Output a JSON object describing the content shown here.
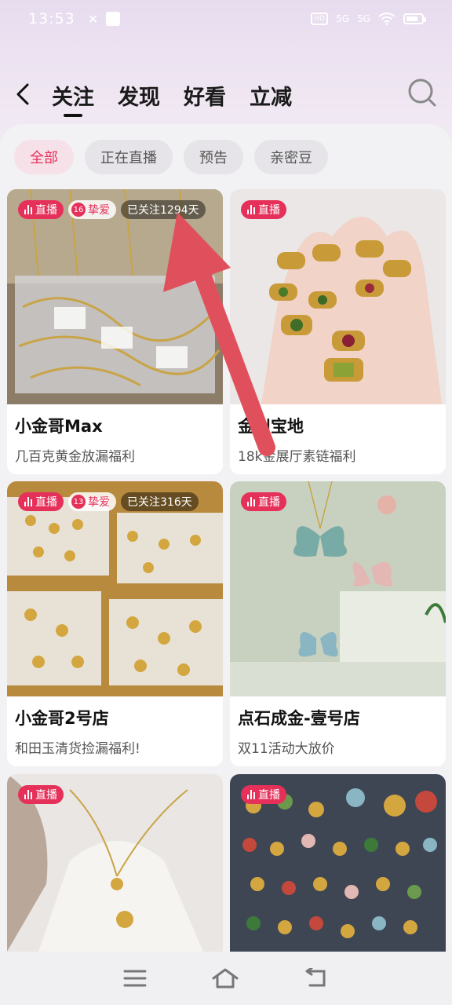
{
  "status_bar": {
    "time": "13:53",
    "icons": [
      "notification-app-icon",
      "app-icon"
    ],
    "right_icons": [
      "hd-icon",
      "5g-signal-icon",
      "5g-signal-icon",
      "wifi-icon",
      "battery-icon"
    ],
    "hd_label": "HD",
    "sig1": "5G",
    "sig2": "5G"
  },
  "nav": {
    "back": "<",
    "tabs": [
      {
        "label": "关注",
        "active": true
      },
      {
        "label": "发现",
        "active": false
      },
      {
        "label": "好看",
        "active": false
      },
      {
        "label": "立减",
        "active": false
      }
    ]
  },
  "filters": [
    {
      "label": "全部",
      "active": true
    },
    {
      "label": "正在直播",
      "active": false
    },
    {
      "label": "预告",
      "active": false
    },
    {
      "label": "亲密豆",
      "active": false
    }
  ],
  "cards": [
    {
      "live": "直播",
      "fan_level": "16",
      "fan_label": "挚爱",
      "follow": "已关注1294天",
      "title": "小金哥Max",
      "subtitle": "几百克黄金放漏福利"
    },
    {
      "live": "直播",
      "title": "金川宝地",
      "subtitle": "18k金展厅素链福利"
    },
    {
      "live": "直播",
      "fan_level": "13",
      "fan_label": "挚爱",
      "follow": "已关注316天",
      "title": "小金哥2号店",
      "subtitle": "和田玉清货捡漏福利!"
    },
    {
      "live": "直播",
      "title": "点石成金-壹号店",
      "subtitle": "双11活动大放价"
    },
    {
      "live": "直播",
      "title": "",
      "subtitle": ""
    },
    {
      "live": "直播",
      "title": "",
      "subtitle": ""
    }
  ],
  "colors": {
    "accent": "#e5315a",
    "arrow": "#e0505c"
  }
}
